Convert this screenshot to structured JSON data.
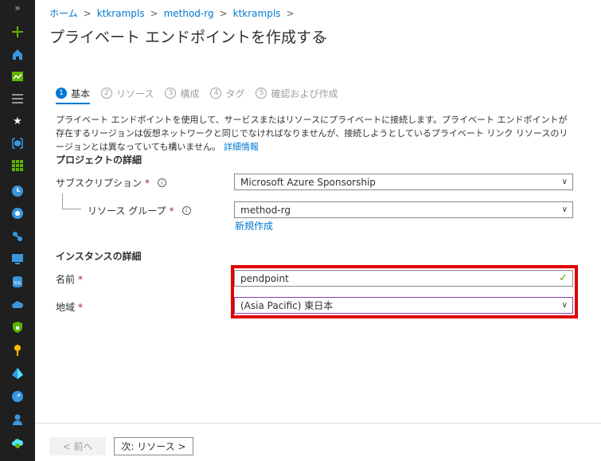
{
  "sidebar": {
    "expand": "»",
    "icons": [
      "create-icon",
      "home-icon",
      "dashboard-icon",
      "all-services-icon",
      "favorites-star-icon",
      "resource-groups-icon",
      "all-resources-icon",
      "recent-clock-icon",
      "app-services-icon",
      "function-app-icon",
      "virtual-machine-icon",
      "sql-database-icon",
      "cloud-services-icon",
      "security-center-icon",
      "key-vault-icon",
      "azure-ad-icon",
      "monitor-icon",
      "advisor-icon",
      "cost-management-icon"
    ]
  },
  "breadcrumb": [
    "ホーム",
    "ktkrampls",
    "method-rg",
    "ktkrampls"
  ],
  "title": "プライベート エンドポイントを作成する",
  "more": "...",
  "tabs": [
    {
      "num": "1",
      "label": "基本"
    },
    {
      "num": "2",
      "label": "リソース"
    },
    {
      "num": "3",
      "label": "構成"
    },
    {
      "num": "4",
      "label": "タグ"
    },
    {
      "num": "5",
      "label": "確認および作成"
    }
  ],
  "description": "プライベート エンドポイントを使用して、サービスまたはリソースにプライベートに接続します。プライベート エンドポイントが存在するリージョンは仮想ネットワークと同じでなければなりませんが、接続しようとしているプライベート リンク リソースのリージョンとは異なっていても構いません。",
  "learn_more": "詳細情報",
  "project": {
    "heading": "プロジェクトの詳細",
    "subscription_label": "サブスクリプション",
    "subscription_value": "Microsoft Azure Sponsorship",
    "rg_label": "リソース グループ",
    "rg_value": "method-rg",
    "create_new": "新規作成"
  },
  "instance": {
    "heading": "インスタンスの詳細",
    "name_label": "名前",
    "name_value": "pendpoint",
    "region_label": "地域",
    "region_value": "(Asia Pacific) 東日本"
  },
  "footer": {
    "prev": "< 前へ",
    "next": "次: リソース >"
  },
  "colors": {
    "accent": "#0078d4",
    "required": "#a4262c",
    "highlight": "#e00000"
  }
}
